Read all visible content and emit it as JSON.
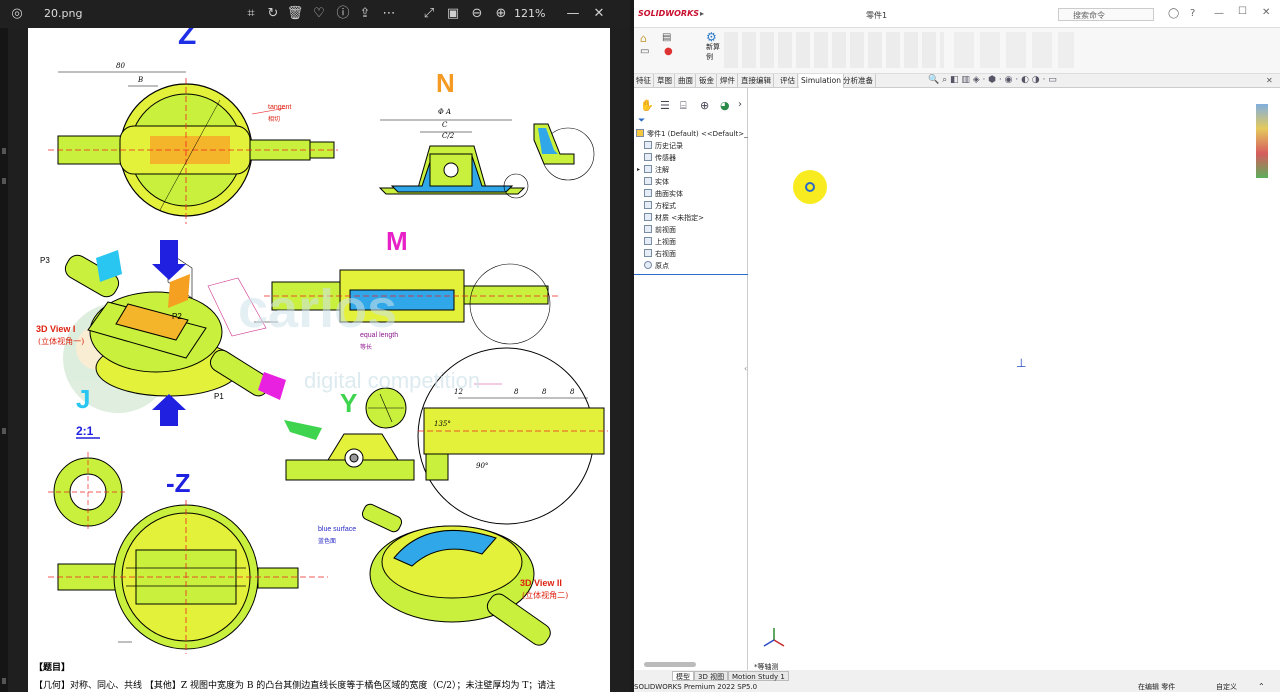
{
  "viewer": {
    "filename": "20.png",
    "zoom": "121%",
    "toolbar_icons": [
      "crop-icon",
      "rotate-icon",
      "delete-icon",
      "favorite-icon",
      "info-icon",
      "share-icon",
      "more-icon",
      "fullscreen-icon",
      "fit-icon",
      "zoom-out-icon",
      "zoom-in-icon"
    ]
  },
  "drawing": {
    "view_z": "Z",
    "view_n": "N",
    "view_m": "M",
    "view_j": "J",
    "view_j_scale": "2:1",
    "view_y": "Y",
    "view_neg_z": "-Z",
    "dim_80": "80",
    "dim_B": "B",
    "dim_phiA": "Φ A",
    "dim_C": "C",
    "dim_C2": "C/2",
    "label_tangent": "tangent",
    "label_tangent_cn": "相切",
    "label_equal_length": "equal length",
    "label_equal_length_cn": "等长",
    "label_3d_view_1": "3D View I",
    "label_3d_view_1_cn": "(立体视角一)",
    "label_3d_view_2": "3D View II",
    "label_3d_view_2_cn": "(立体视角二)",
    "label_blue_surface": "blue surface",
    "label_blue_surface_cn": "蓝色面",
    "label_p1": "P1",
    "label_p2": "P2",
    "label_p3": "P3",
    "dim_12": "12",
    "dim_8a": "8",
    "dim_8b": "8",
    "dim_8c": "8",
    "dim_135": "135°",
    "dim_90": "90°",
    "watermark_1": "carlos",
    "watermark_2": "digital competition",
    "section_heading": "【题目】",
    "task_text": "【几何】对称、同心、共线 【其他】Z 视图中宽度为 B 的凸台其侧边直线长度等于橘色区域的宽度（C/2）；未注壁厚均为 T；请注"
  },
  "solidworks": {
    "app_name": "SOLIDWORKS",
    "doc_title": "零件1",
    "search_placeholder": "搜索命令",
    "ribbon_new": "新算例",
    "tabs": [
      "特征",
      "草图",
      "曲面",
      "钣金",
      "焊件",
      "直接编辑",
      "评估",
      "Simulation",
      "分析准备"
    ],
    "active_tab": "Simulation",
    "tree_root": "零件1 (Default) <<Default>_P",
    "tree_items": [
      "历史记录",
      "传感器",
      "注解",
      "实体",
      "曲面实体",
      "方程式",
      "材质 <未指定>",
      "前视面",
      "上视面",
      "右视面",
      "原点"
    ],
    "bottom_tabs": [
      "模型",
      "3D 视图",
      "Motion Study 1"
    ],
    "view_label": "*等轴测",
    "status_left": "SOLIDWORKS Premium 2022 SP5.0",
    "status_mid": "在编辑 零件",
    "status_right": "自定义"
  }
}
